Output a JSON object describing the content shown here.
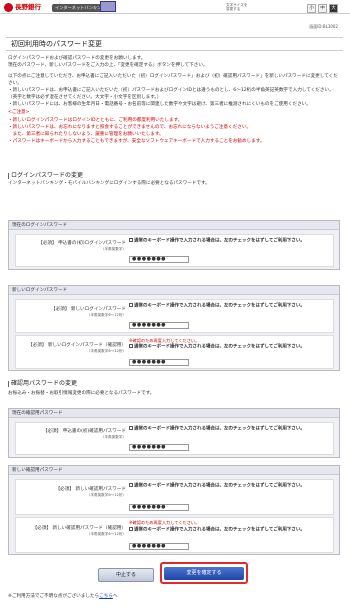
{
  "header": {
    "bank": "長野銀行",
    "service": "インターネットバンキング",
    "fontsize_label1": "文字サイズを",
    "fontsize_label2": "変更する",
    "font_small": "小",
    "font_medium": "中",
    "font_large": "大"
  },
  "screen_id": "画面ID:BL3002",
  "page_title": "初回利用時のパスワード変更",
  "intro": [
    "ログインパスワードおよび確認パスワードの変更をお願いします。",
    "現在のパスワード、新しいパスワードをご入力の上、「変更を確定する」ボタンを押して下さい。",
    "以下の点にご注意していただき、お申込書にご記入いただいた（初）ログインパスワード」および（初）確認用パスワード」を新しいパスワードに変更してください。",
    "・新しいパスワードは、お申込書にご記入いただいた（初）パスワードおよびログインIDとは違うものとし、6～12桁の半角英記英数字で入力してください。",
    "（英字と数字は必ず混在させてください。大文字・小文字を区別します。）",
    "・新しいパスワードには、お客様の生年月日・電話番号・お名前等に関連した数字や文字は避け、第三者に推測されにくいものをご使用ください。"
  ],
  "notes_title": "<ご注意>",
  "notes": [
    "・新しいログインパスワードはログインIDとともに、ご利用の都度利用いたします。",
    "・新しいパスワードは、お忘れになりますと照会することができませんので、お忘れにならないようご注意ください。",
    "　また、第三者に知られたりしないよう、厳重に管理をお願いいたします。",
    "・パスワードはキーボードから入力することもできますが、安全なソフトウェアキーボードで入力することをお勧めします。"
  ],
  "login_section": {
    "title": "ログインパスワードの変更",
    "desc": "インターネットバンキング・モバイルバンキングにログインする際に必要となるパスワードです。"
  },
  "current_login": {
    "box_title": "現在のログインパスワード",
    "label": "【必須】 申込書の(初)ログインパスワード",
    "sub": "（半角英数字）",
    "check": "通常のキーボード操作で入力される場合は、左のチェックをはずしてご利用下さい。",
    "value": "●●●●●●●"
  },
  "new_login": {
    "box_title": "新しいログインパスワード",
    "label1": "【必須】 新しいログインパスワード",
    "sub1": "（半角英数字6～12桁）",
    "check1": "通常のキーボード操作で入力される場合は、左のチェックをはずしてご利用下さい。",
    "value1": "●●●●●●●",
    "label2": "【必須】 新しいログインパスワード（確認用）",
    "sub2": "（半角英数字6～12桁）",
    "error": "※確認のため再度入力してください。",
    "check2": "通常のキーボード操作で入力される場合は、左のチェックをはずしてご利用下さい。",
    "value2": "●●●●●●●"
  },
  "confirm_section": {
    "title": "確認用パスワードの変更",
    "desc": "お振込み・お振替・お取引情報変更の際に必要となるパスワードです。"
  },
  "current_confirm": {
    "box_title": "現在の確認用パスワード",
    "label": "【必須】 申込書の(初)確認用パスワード",
    "sub": "（半角英数字）",
    "check": "通常のキーボード操作で入力される場合は、左のチェックをはずしてご利用下さい。",
    "value": "●●●●●●●"
  },
  "new_confirm": {
    "box_title": "新しい確認用パスワード",
    "label1": "【必須】 新しい確認用パスワード",
    "sub1": "（半角英数字6～12桁）",
    "check1": "通常のキーボード操作で入力される場合は、左のチェックをはずしてご利用下さい。",
    "value1": "●●●●●●●",
    "label2": "【必須】 新しい確認用パスワード（確認用）",
    "sub2": "（半角英数字6～12桁）",
    "error": "※確認のため再度入力してください。",
    "check2": "通常のキーボード操作で入力される場合は、左のチェックをはずしてご利用下さい。",
    "value2": "●●●●●●●"
  },
  "buttons": {
    "cancel": "中止する",
    "confirm": "変更を確定する"
  },
  "footer": {
    "text": "※ご利用方法でご不明な点がございましたら",
    "link": "こちら",
    "suffix": "へ"
  }
}
